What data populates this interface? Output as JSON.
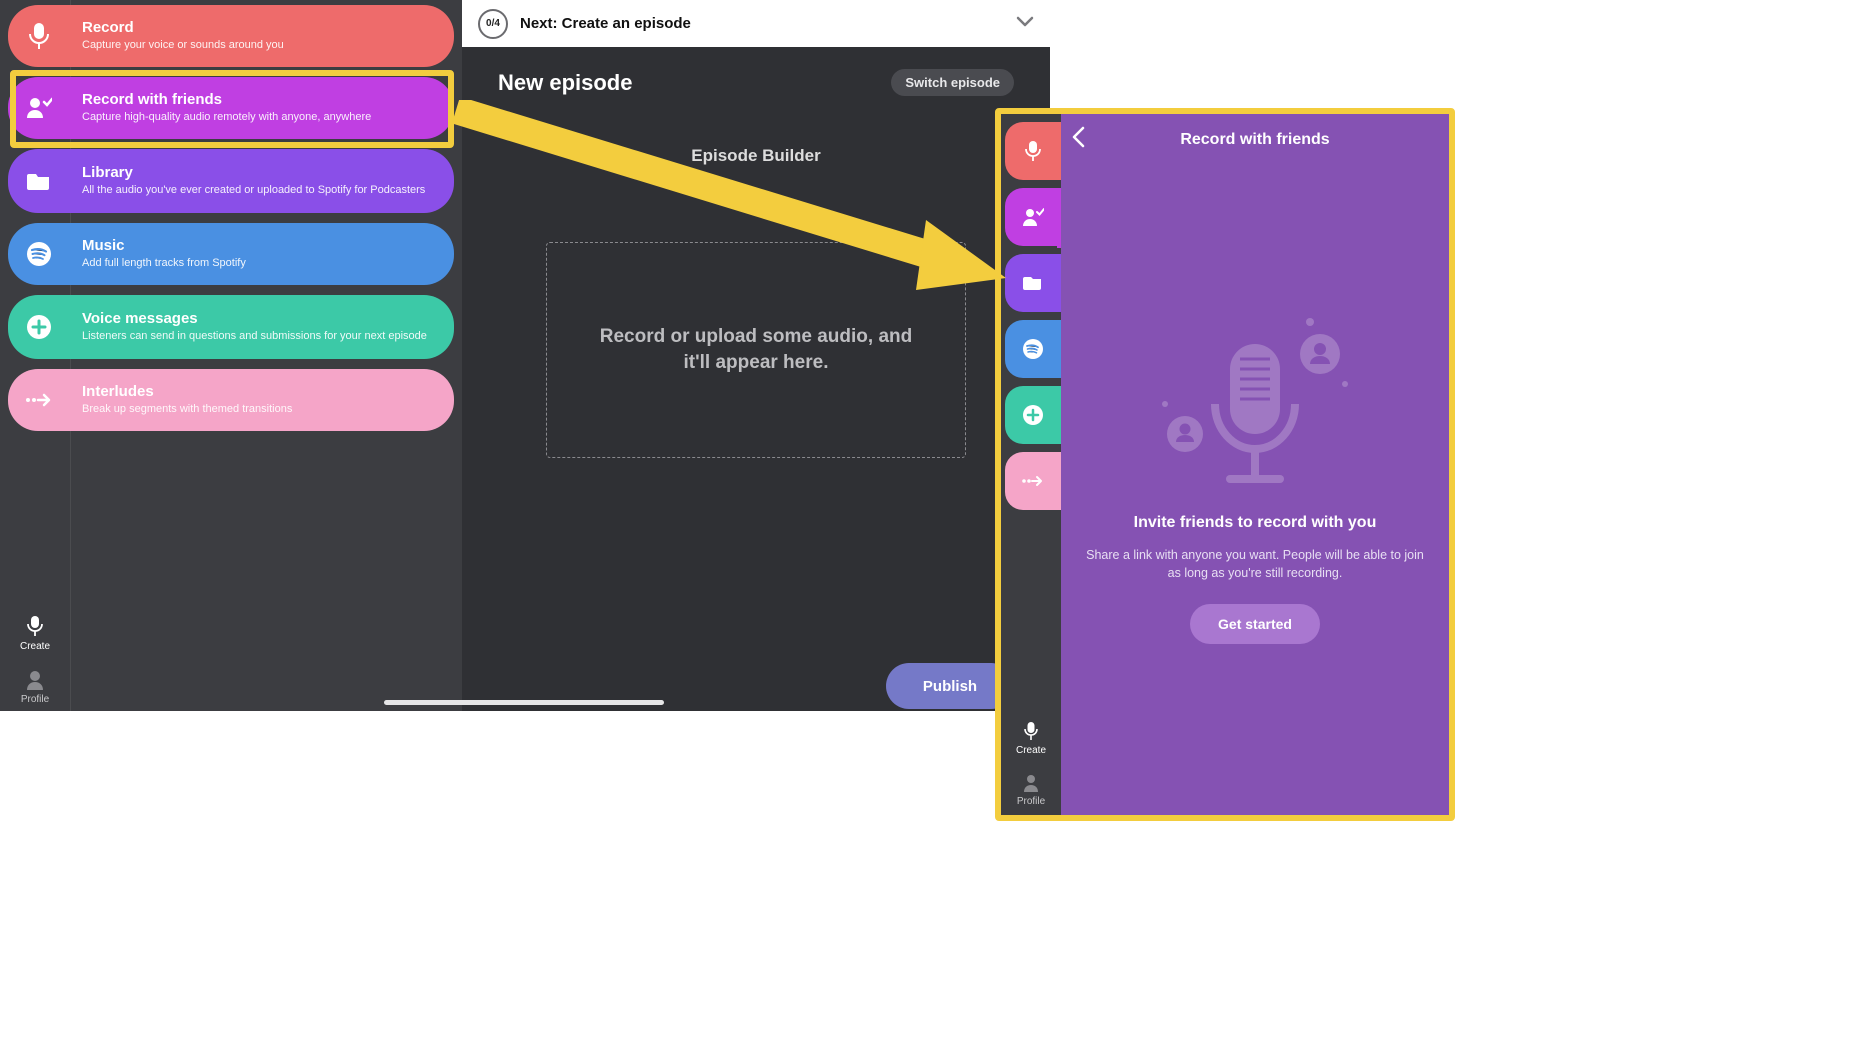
{
  "left": {
    "sidebar": {
      "record": {
        "title": "Record",
        "sub": "Capture your voice or sounds around you"
      },
      "friends": {
        "title": "Record with friends",
        "sub": "Capture high-quality audio remotely with anyone, anywhere"
      },
      "library": {
        "title": "Library",
        "sub": "All the audio you've ever created or uploaded to Spotify for Podcasters"
      },
      "music": {
        "title": "Music",
        "sub": "Add full length tracks from Spotify"
      },
      "voice": {
        "title": "Voice messages",
        "sub": "Listeners can send in questions and submissions for your next episode"
      },
      "interludes": {
        "title": "Interludes",
        "sub": "Break up segments with themed transitions"
      }
    },
    "bottom": {
      "create": "Create",
      "profile": "Profile"
    },
    "topbar": {
      "progress": "0/4",
      "next": "Next: Create an episode"
    },
    "main": {
      "title": "New episode",
      "switch": "Switch episode",
      "builder": "Episode Builder",
      "dropzone": "Record or upload some audio, and it'll appear here.",
      "publish": "Publish"
    }
  },
  "right": {
    "header": "Record with friends",
    "invite_title": "Invite friends to record with you",
    "invite_sub": "Share a link with anyone you want. People will be able to join as long as you're still recording.",
    "get_started": "Get started",
    "bottom": {
      "create": "Create",
      "profile": "Profile"
    }
  },
  "colors": {
    "highlight": "#f3cd3e",
    "record": "#ee6b6b",
    "friends": "#c03fe2",
    "library": "#8a4fe8",
    "music": "#4a90e2",
    "voice": "#3cc9a7",
    "interludes": "#f5a5c8",
    "panel": "#8552b3",
    "publish": "#7579c8"
  }
}
